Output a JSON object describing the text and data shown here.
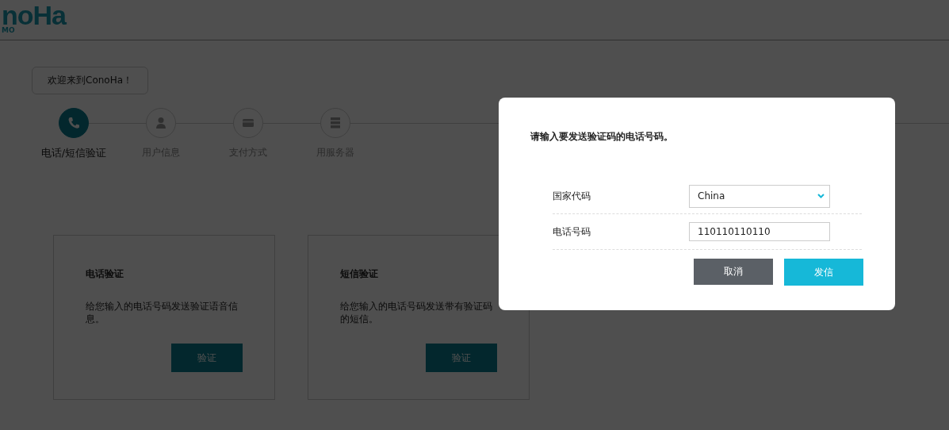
{
  "header": {
    "logo": "noHa",
    "logo_sub": "MO"
  },
  "tooltip": "欢迎来到ConoHa！",
  "steps": [
    {
      "label": "电话/短信验证",
      "selected": true,
      "kind": "phone"
    },
    {
      "label": "用户信息",
      "selected": false,
      "kind": "user"
    },
    {
      "label": "支付方式",
      "selected": false,
      "kind": "card"
    },
    {
      "label": "用服务器",
      "selected": false,
      "kind": "server"
    }
  ],
  "cards": [
    {
      "title": "电话验证",
      "description": "给您输入的电话号码发送验证语音信息。",
      "button": "验证"
    },
    {
      "title": "短信验证",
      "description": "给您输入的电话号码发送带有验证码的短信。",
      "button": "验证"
    }
  ],
  "dialog": {
    "title": "请输入要发送验证码的电话号码。",
    "fields": [
      {
        "label": "国家代码",
        "kind": "select",
        "value": "China"
      },
      {
        "label": "电话号码",
        "kind": "text",
        "value": "110110110110"
      }
    ],
    "buttons": [
      {
        "label": "取消",
        "kind": "secondary"
      },
      {
        "label": "发信",
        "kind": "primary"
      }
    ]
  }
}
